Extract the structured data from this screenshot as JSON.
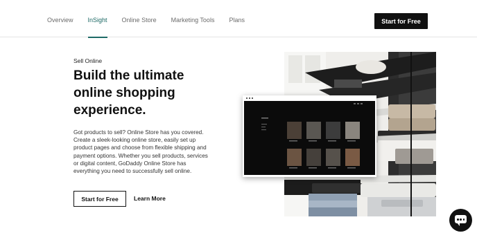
{
  "nav": {
    "tabs": [
      {
        "label": "Overview",
        "active": false
      },
      {
        "label": "InSight",
        "active": true
      },
      {
        "label": "Online Store",
        "active": false
      },
      {
        "label": "Marketing Tools",
        "active": false
      },
      {
        "label": "Plans",
        "active": false
      }
    ],
    "cta_label": "Start for Free"
  },
  "hero": {
    "eyebrow": "Sell Online",
    "headline": "Build the ultimate online shopping experience.",
    "body": "Got products to sell? Online Store has you covered. Create a sleek-looking online store, easily set up product pages and choose from flexible shipping and payment options. Whether you sell products, services or digital content, GoDaddy Online Store has everything you need to successfully sell online.",
    "primary_button": "Start for Free",
    "secondary_link": "Learn More"
  },
  "colors": {
    "accent": "#1e6a66",
    "cta_bg": "#111111",
    "text": "#111111"
  },
  "icons": {
    "chat": "chat-bubble-icon",
    "mock_dots": "window-dots-icon"
  }
}
